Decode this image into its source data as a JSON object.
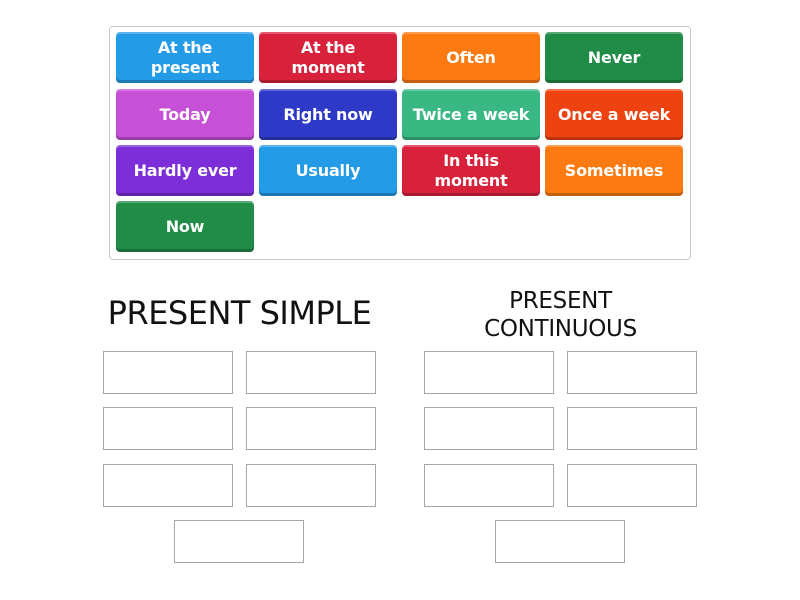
{
  "word_bank": {
    "tiles": [
      {
        "label": "At the\npresent",
        "color": "#249be6"
      },
      {
        "label": "At the\nmoment",
        "color": "#d8213b"
      },
      {
        "label": "Often",
        "color": "#fb7a12"
      },
      {
        "label": "Never",
        "color": "#218c47"
      },
      {
        "label": "Today",
        "color": "#c650d6"
      },
      {
        "label": "Right now",
        "color": "#2e3ac7"
      },
      {
        "label": "Twice a week",
        "color": "#3ab884"
      },
      {
        "label": "Once a week",
        "color": "#ee4310"
      },
      {
        "label": "Hardly ever",
        "color": "#7c2fd9"
      },
      {
        "label": "Usually",
        "color": "#249be6"
      },
      {
        "label": "In this\nmoment",
        "color": "#d8213b"
      },
      {
        "label": "Sometimes",
        "color": "#fb7a12"
      },
      {
        "label": "Now",
        "color": "#218c47"
      }
    ]
  },
  "groups": [
    {
      "title": "PRESENT SIMPLE",
      "slot_count": 7
    },
    {
      "title": "PRESENT\nCONTINUOUS",
      "slot_count": 7
    }
  ]
}
